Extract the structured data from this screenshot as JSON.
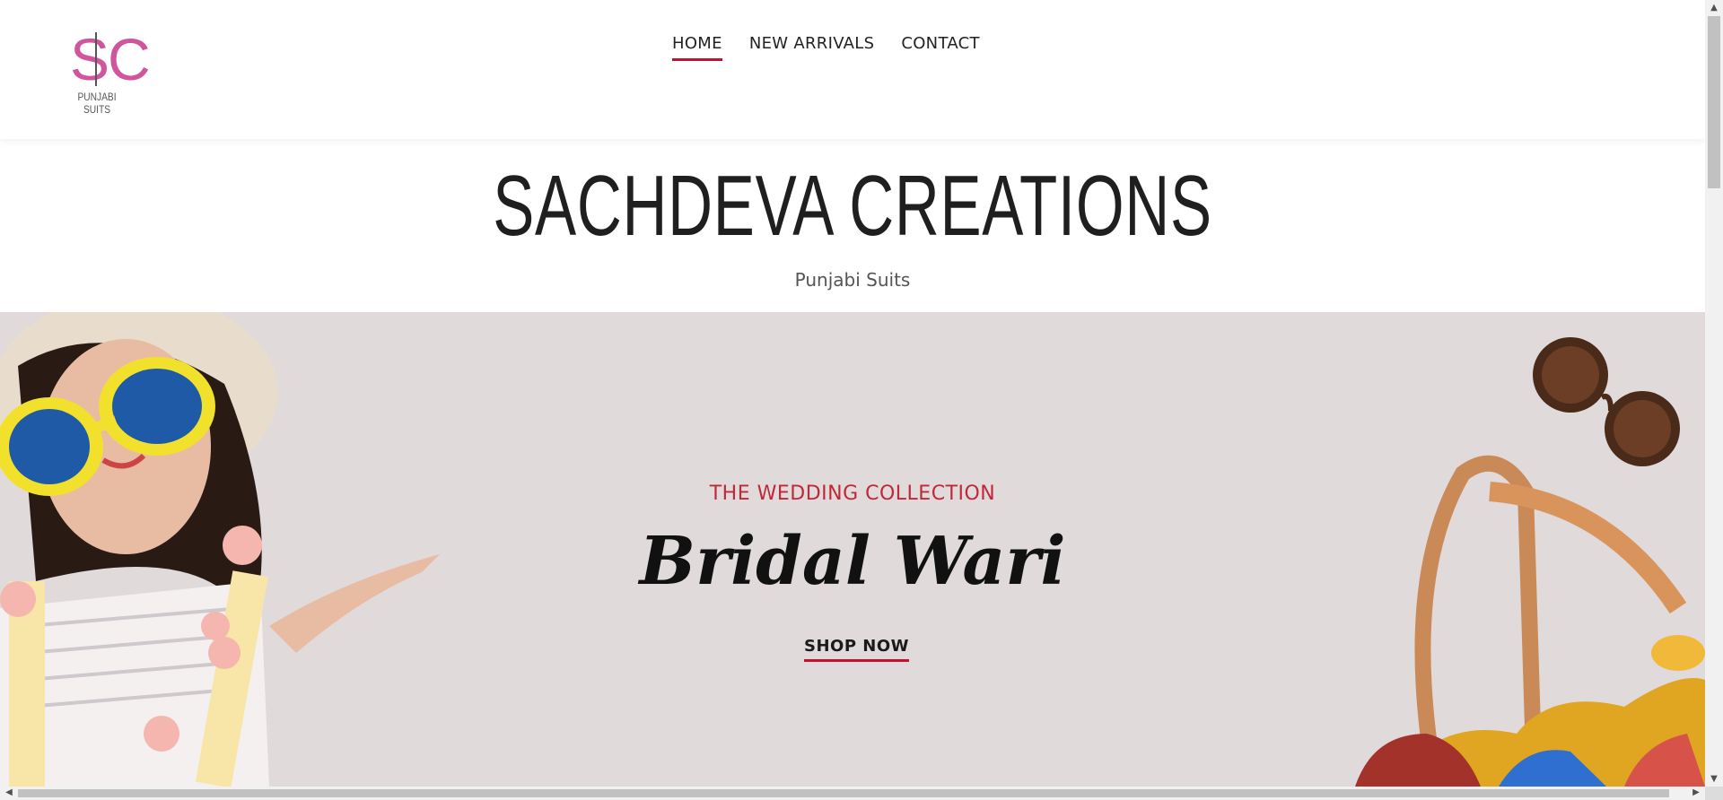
{
  "logo": {
    "mark": "SC",
    "text": "PUNJABI SUITS",
    "color": "#d0559d"
  },
  "nav": {
    "items": [
      {
        "label": "HOME",
        "active": true
      },
      {
        "label": "NEW ARRIVALS",
        "active": false
      },
      {
        "label": "CONTACT",
        "active": false
      }
    ]
  },
  "brand": {
    "title": "SACHDEVA CREATIONS",
    "subtitle": "Punjabi Suits"
  },
  "hero": {
    "eyebrow": "THE WEDDING COLLECTION",
    "title": "Bridal Wari",
    "cta": "SHOP NOW",
    "background": "#e0dada",
    "accent": "#c8102e"
  },
  "scroll": {
    "up": "▲",
    "down": "▼",
    "left": "◀",
    "right": "▶"
  }
}
